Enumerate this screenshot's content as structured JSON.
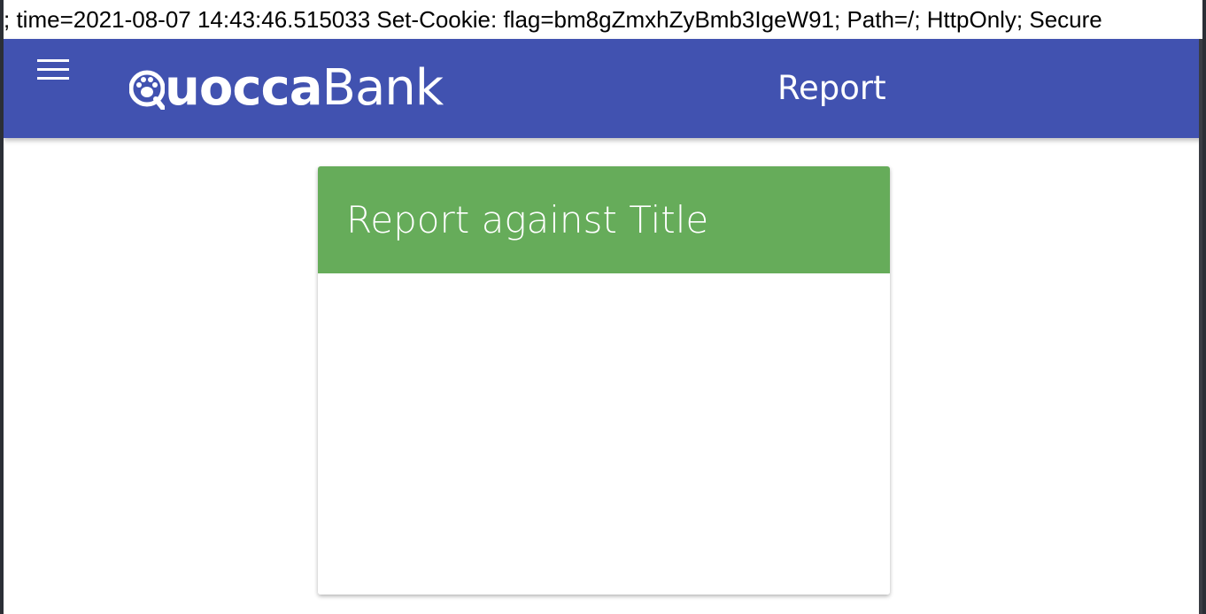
{
  "response_header_line": "; time=2021-08-07 14:43:46.515033 Set-Cookie: flag=bm8gZmxhZyBmb3IgeW91; Path=/; HttpOnly; Secure",
  "navbar": {
    "menu_icon": "hamburger-menu-icon",
    "logo": {
      "text_bold": "uocca",
      "text_regular": "Bank",
      "icon": "paw-q-icon"
    },
    "page_title": "Report"
  },
  "card": {
    "title": "Report against Title",
    "header_color": "#66ac5a"
  },
  "colors": {
    "navbar": "#4152b0",
    "card_header": "#66ac5a"
  }
}
